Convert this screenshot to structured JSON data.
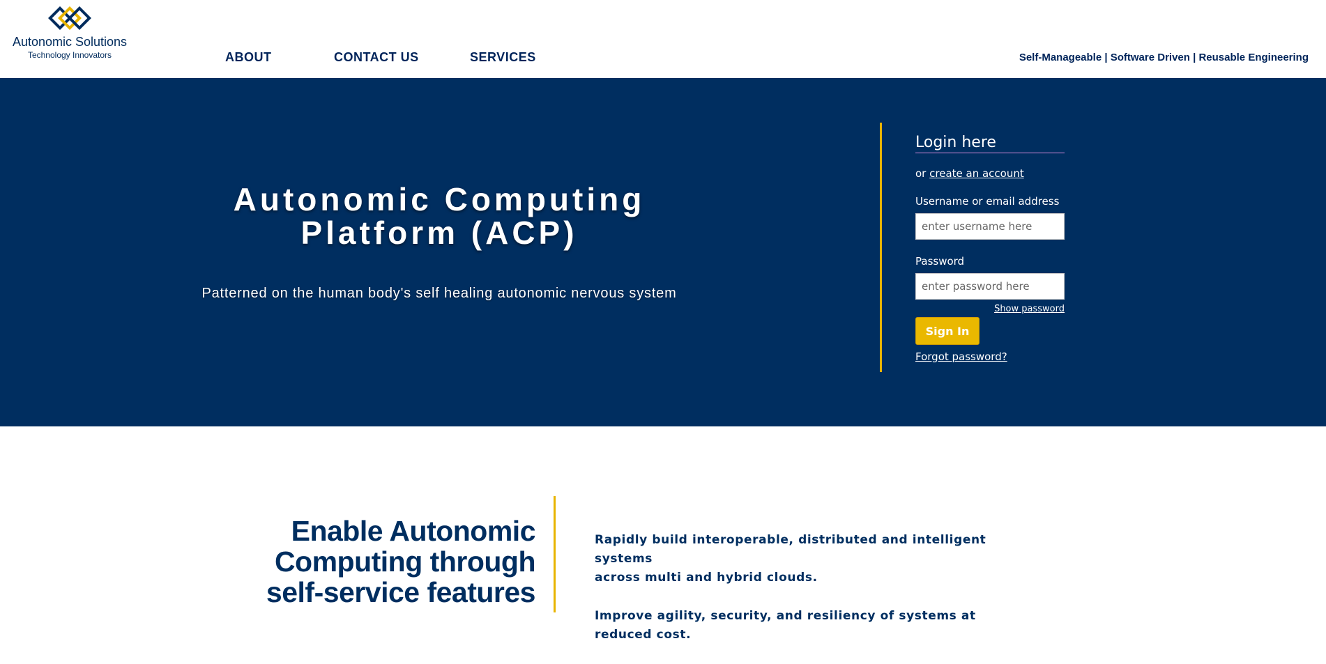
{
  "header": {
    "brand": "Autonomic Solutions",
    "tagline": "Technology Innovators",
    "nav": [
      {
        "label": "ABOUT"
      },
      {
        "label": "CONTACT US"
      },
      {
        "label": "SERVICES"
      }
    ],
    "motto": "Self-Manageable | Software Driven | Reusable Engineering"
  },
  "hero": {
    "title_line1": "Autonomic Computing",
    "title_line2": "Platform (ACP)",
    "subtitle": "Patterned on the human body's self healing autonomic nervous system"
  },
  "login": {
    "heading": "Login here",
    "or_text": "or",
    "create_account": "create an account",
    "username_label": "Username or email address",
    "username_placeholder": "enter username here",
    "username_value": "",
    "password_label": "Password",
    "password_placeholder": "enter password here",
    "password_value": "",
    "show_password": "Show password",
    "sign_in": "Sign In",
    "forgot": "Forgot password?"
  },
  "lower": {
    "title_line1": "Enable Autonomic",
    "title_line2": "Computing through",
    "title_line3": "self-service features",
    "para1_line1": "Rapidly build interoperable, distributed and intelligent systems",
    "para1_line2": "across multi and hybrid clouds.",
    "para2": "Improve agility, security, and resiliency of systems at reduced cost."
  },
  "colors": {
    "navy": "#002e60",
    "accent_gold": "#eab800",
    "white": "#ffffff"
  }
}
